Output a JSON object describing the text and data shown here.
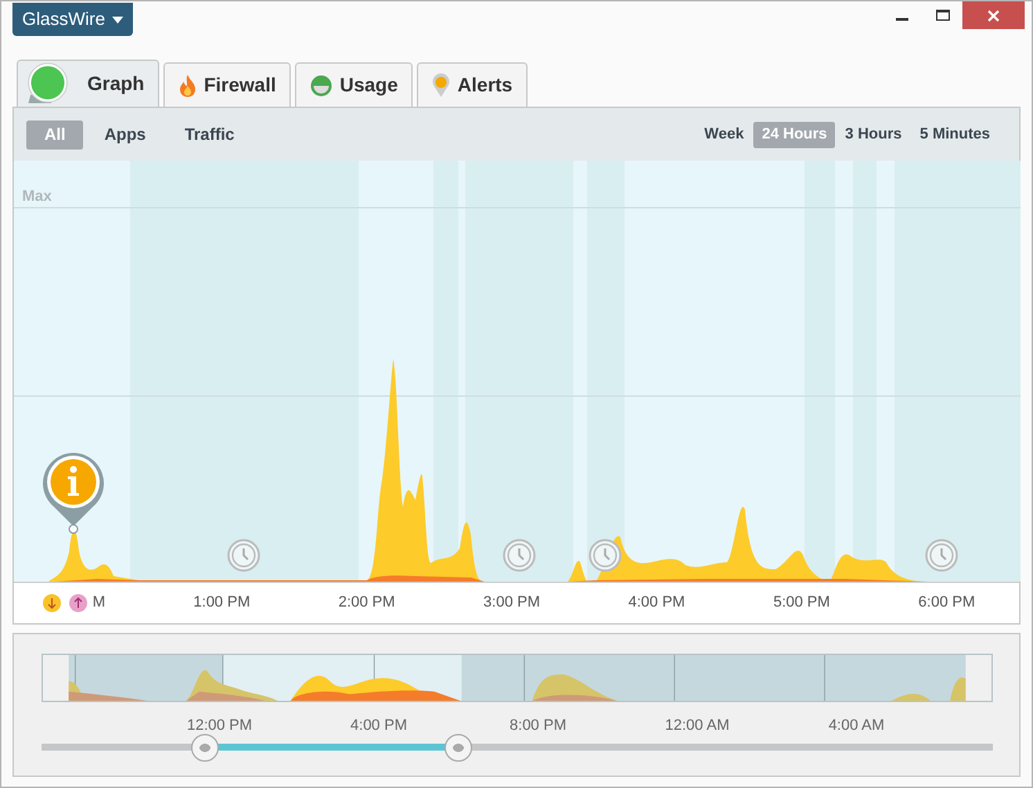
{
  "app_menu": {
    "label": "GlassWire"
  },
  "tabs": [
    {
      "label": "Graph",
      "kind": "graph",
      "selected": true
    },
    {
      "label": "Firewall",
      "kind": "firewall",
      "selected": false
    },
    {
      "label": "Usage",
      "kind": "usage",
      "selected": false
    },
    {
      "label": "Alerts",
      "kind": "alerts",
      "selected": false
    }
  ],
  "filters": [
    {
      "label": "All",
      "selected": true
    },
    {
      "label": "Apps",
      "selected": false
    },
    {
      "label": "Traffic",
      "selected": false
    }
  ],
  "ranges": [
    {
      "label": "Week",
      "selected": false
    },
    {
      "label": "24 Hours",
      "selected": true
    },
    {
      "label": "3 Hours",
      "selected": false
    },
    {
      "label": "5 Minutes",
      "selected": false
    }
  ],
  "graph": {
    "max_label": "Max",
    "x_labels": [
      "M",
      "1:00 PM",
      "2:00 PM",
      "3:00 PM",
      "4:00 PM",
      "5:00 PM",
      "6:00 PM"
    ]
  },
  "overview": {
    "x_labels": [
      "12:00 PM",
      "4:00 PM",
      "8:00 PM",
      "12:00 AM",
      "4:00 AM"
    ],
    "range_slider": {
      "handles": [
        {
          "level": 0.172
        },
        {
          "level": 0.438
        }
      ]
    }
  }
}
